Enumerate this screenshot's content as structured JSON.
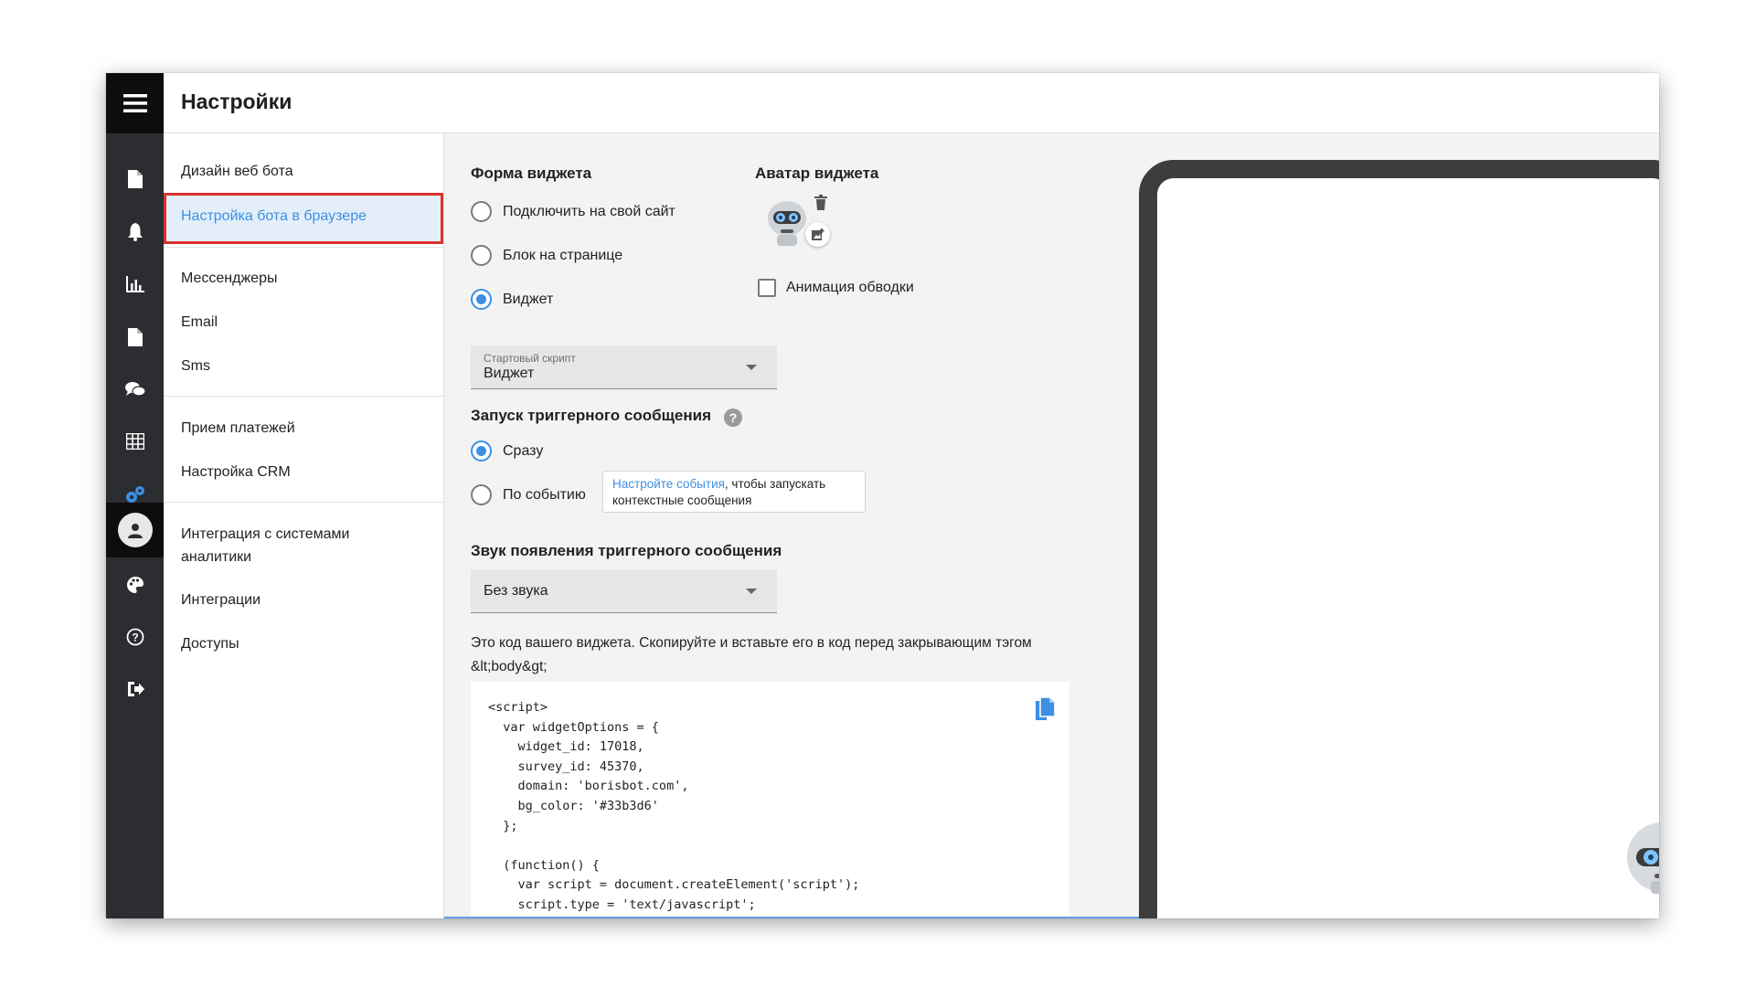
{
  "header": {
    "title": "Настройки"
  },
  "rail": {
    "icons": [
      "menu-icon",
      "document-icon",
      "bell-icon",
      "bar-chart-icon",
      "file-icon",
      "chat-icon",
      "table-icon",
      "gears-icon",
      "user-avatar-icon",
      "palette-icon",
      "help-circle-icon",
      "logout-icon"
    ],
    "active_color": "#3d8fe3"
  },
  "menu": {
    "items": [
      {
        "label": "Дизайн веб бота"
      },
      {
        "label": "Настройка бота в браузере",
        "active": true
      },
      {
        "label": "Мессенджеры"
      },
      {
        "label": "Email"
      },
      {
        "label": "Sms"
      },
      {
        "label": "Прием платежей"
      },
      {
        "label": "Настройка CRM"
      },
      {
        "label": "Интеграция с системами аналитики"
      },
      {
        "label": "Интеграции"
      },
      {
        "label": "Доступы"
      }
    ]
  },
  "widget_form": {
    "title": "Форма виджета",
    "options": [
      {
        "label": "Подключить на свой сайт",
        "checked": false
      },
      {
        "label": "Блок на странице",
        "checked": false
      },
      {
        "label": "Виджет",
        "checked": true
      }
    ]
  },
  "avatar": {
    "title": "Аватар виджета",
    "animation_label": "Анимация обводки",
    "animation_checked": false
  },
  "start_script": {
    "label": "Стартовый скрипт",
    "value": "Виджет"
  },
  "trigger": {
    "title": "Запуск триггерного сообщения",
    "help": "?",
    "options": [
      {
        "label": "Сразу",
        "checked": true
      },
      {
        "label": "По событию",
        "checked": false
      }
    ],
    "hint_link": "Настройте события",
    "hint_text": ", чтобы запускать контекстные сообщения"
  },
  "sound": {
    "title": "Звук появления триггерного сообщения",
    "value": "Без звука"
  },
  "code": {
    "description": "Это код вашего виджета. Скопируйте и вставьте его в код перед закрывающим тэгом &lt;body&gt;",
    "snippet": "<script>\n  var widgetOptions = {\n    widget_id: 17018,\n    survey_id: 45370,\n    domain: 'borisbot.com',\n    bg_color: '#33b3d6'\n  };\n\n  (function() {\n    var script = document.createElement('script');\n    script.type = 'text/javascript';"
  },
  "colors": {
    "accent": "#3d8fe3",
    "highlight_border": "#d9322b",
    "rail_bg": "#2b2d31"
  }
}
